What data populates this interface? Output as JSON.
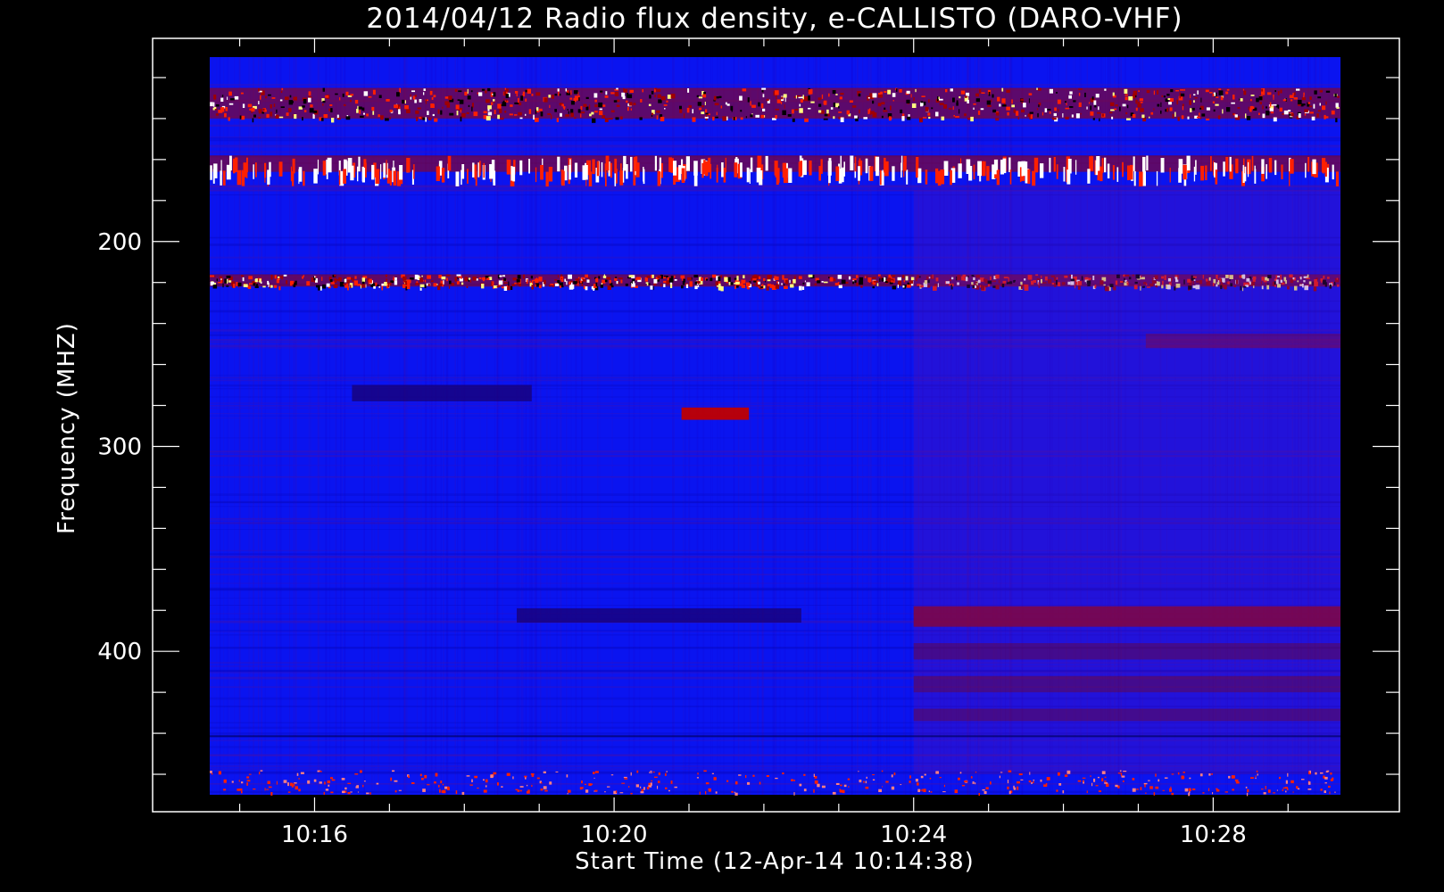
{
  "chart_data": {
    "type": "heatmap",
    "title": "2014/04/12  Radio flux density, e-CALLISTO (DARO-VHF)",
    "xlabel": "Start Time (12-Apr-14 10:14:38)",
    "ylabel": "Frequency (MHZ)",
    "x_tick_labels": [
      "10:16",
      "10:20",
      "10:24",
      "10:28"
    ],
    "x_ticks_min": [
      16,
      20,
      24,
      28
    ],
    "x_range_min": [
      14.6,
      29.7
    ],
    "y_tick_labels": [
      "200",
      "300",
      "400"
    ],
    "y_ticks_mhz": [
      200,
      300,
      400
    ],
    "y_range_mhz": [
      110,
      470
    ],
    "y_inverted": true,
    "colormap": "blue-red-yellow-white",
    "colors": {
      "background": "#0a14f0",
      "low": "#1a0070",
      "mid": "#a00000",
      "high": "#ff2000",
      "peak": "#ffff80"
    },
    "features": [
      {
        "kind": "persistent interference band",
        "freq_mhz": [
          125,
          140
        ]
      },
      {
        "kind": "persistent interference band",
        "freq_mhz": [
          158,
          166
        ]
      },
      {
        "kind": "persistent interference band",
        "freq_mhz": [
          216,
          222
        ]
      },
      {
        "kind": "red burst",
        "time_min": [
          20.9,
          21.8
        ],
        "freq_mhz": [
          281,
          287
        ]
      },
      {
        "kind": "red band",
        "time_min": [
          24.0,
          29.7
        ],
        "freq_mhz": [
          378,
          388
        ]
      },
      {
        "kind": "dark band",
        "time_min": [
          18.7,
          22.5
        ],
        "freq_mhz": [
          379,
          386
        ]
      },
      {
        "kind": "dark band",
        "time_min": [
          16.5,
          18.9
        ],
        "freq_mhz": [
          270,
          278
        ]
      },
      {
        "kind": "faint red band",
        "time_min": [
          27.1,
          29.7
        ],
        "freq_mhz": [
          245,
          252
        ]
      }
    ]
  }
}
